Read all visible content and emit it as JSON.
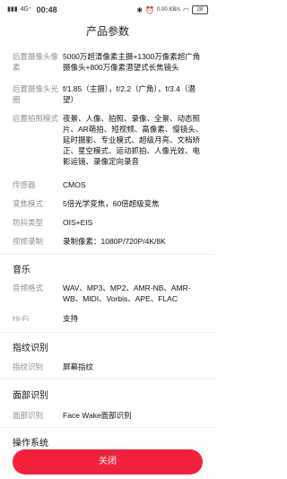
{
  "statusbar": {
    "network_left": "4G⁺",
    "signal": "▮▮▮",
    "time": "00:48",
    "speed": "0.00 KB/s",
    "battery": "28"
  },
  "title": "产品参数",
  "camera": {
    "rear_pixels_label": "后置摄像头像素",
    "rear_pixels_value": "5000万超清像素主摄+1300万像素超广角摄像头+800万像素潜望式长焦镜头",
    "rear_aperture_label": "后置摄像头光圈",
    "rear_aperture_value": "f/1.85（主摄），f/2.2（广角），f/3.4（潜望）",
    "rear_modes_label": "后置拍照模式",
    "rear_modes_value": "夜景、人像、拍照、录像、全景、动态照片、AR萌拍、短视频、高像素、慢镜头、延时摄影、专业模式、超级月亮、文档矫正、星空模式、运动抓拍、人像光效、电影运镜、录像定向录音",
    "sensor_label": "传感器",
    "sensor_value": "CMOS",
    "zoom_label": "变焦模式",
    "zoom_value": "5倍光学变焦，60倍超级变焦",
    "stabilization_label": "防抖类型",
    "stabilization_value": "OIS+EIS",
    "video_label": "视频录制",
    "video_value": "录制像素：1080P/720P/4K/8K"
  },
  "music": {
    "title": "音乐",
    "format_label": "音频格式",
    "format_value": "WAV、MP3、MP2、AMR-NB、AMR-WB、MIDI、Vorbis、APE、FLAC",
    "hifi_label": "Hi-Fi",
    "hifi_value": "支持"
  },
  "fingerprint": {
    "title": "指纹识别",
    "label": "指纹识别",
    "value": "屏幕指纹"
  },
  "face": {
    "title": "面部识别",
    "label": "面部识别",
    "value": "Face Wake面部识别"
  },
  "os": {
    "title": "操作系统"
  },
  "close_label": "关闭"
}
